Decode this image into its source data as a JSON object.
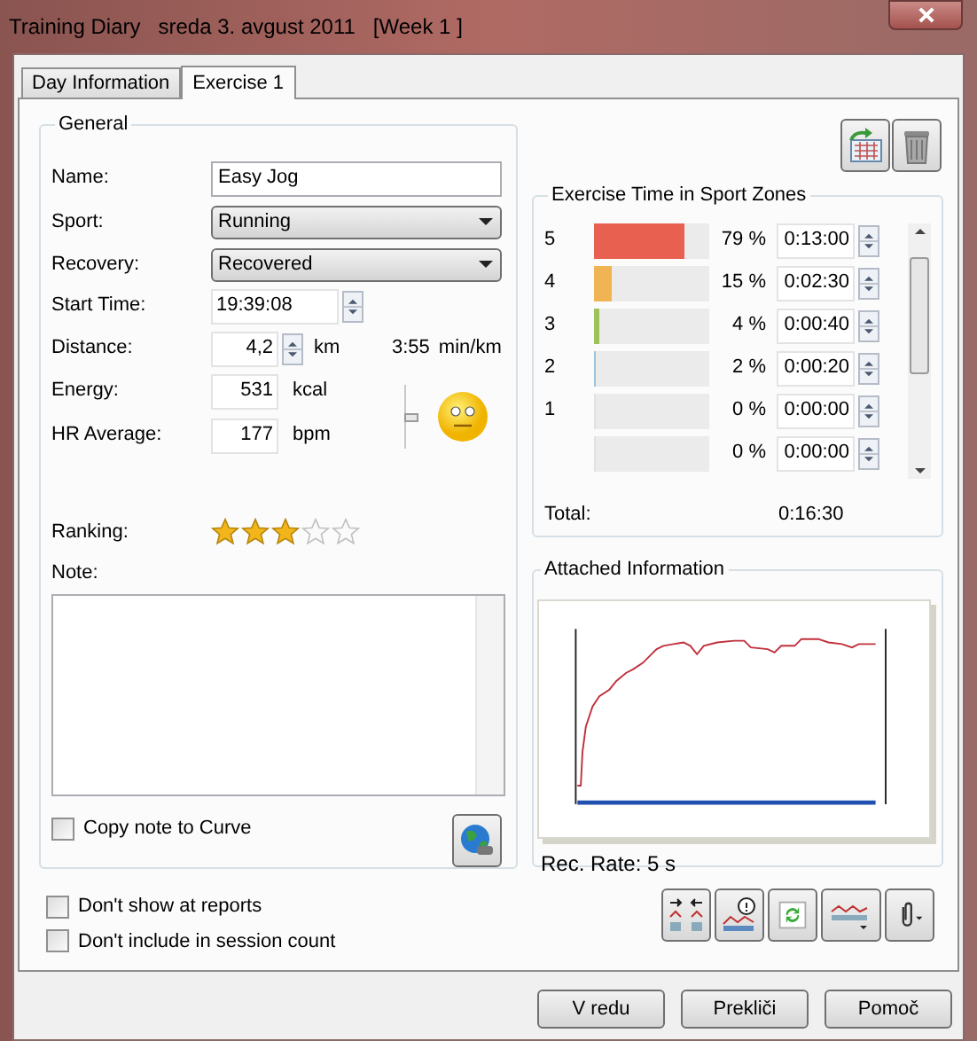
{
  "window": {
    "title": "Training Diary   sreda 3. avgust 2011   [Week 1 ]"
  },
  "tabs": [
    {
      "label": "Day Information",
      "selected": false
    },
    {
      "label": "Exercise 1",
      "selected": true
    }
  ],
  "general": {
    "legend": "General",
    "name": {
      "label": "Name:",
      "value": "Easy Jog"
    },
    "sport": {
      "label": "Sport:",
      "value": "Running"
    },
    "recovery": {
      "label": "Recovery:",
      "value": "Recovered"
    },
    "start_time": {
      "label": "Start Time:",
      "value": "19:39:08"
    },
    "distance": {
      "label": "Distance:",
      "value": "4,2",
      "unit": "km",
      "pace": "3:55",
      "pace_unit": "min/km"
    },
    "energy": {
      "label": "Energy:",
      "value": "531",
      "unit": "kcal"
    },
    "hr_average": {
      "label": "HR Average:",
      "value": "177",
      "unit": "bpm"
    },
    "feeling": {
      "level": 0.5
    },
    "ranking": {
      "label": "Ranking:",
      "stars": 3
    },
    "note": {
      "label": "Note:"
    },
    "copy_note": {
      "label": "Copy note to Curve",
      "checked": false
    }
  },
  "zones": {
    "legend": "Exercise Time in Sport Zones",
    "rows": [
      {
        "zone": "5",
        "level": 0.79,
        "percent": "79 %",
        "time": "0:13:00",
        "color": "#e8604f"
      },
      {
        "zone": "4",
        "level": 0.15,
        "percent": "15 %",
        "time": "0:02:30",
        "color": "#f0b454"
      },
      {
        "zone": "3",
        "level": 0.04,
        "percent": "4 %",
        "time": "0:00:40",
        "color": "#9dc25a"
      },
      {
        "zone": "2",
        "level": 0.02,
        "percent": "2 %",
        "time": "0:00:20",
        "color": "#9cc4dc"
      },
      {
        "zone": "1",
        "level": 0,
        "percent": "0 %",
        "time": "0:00:00"
      },
      {
        "level": 0,
        "percent": "0 %",
        "time": "0:00:00"
      }
    ],
    "total_label": "Total:",
    "total": "0:16:30"
  },
  "attached": {
    "legend": "Attached Information",
    "rec_rate": "Rec. Rate: 5 s"
  },
  "options": [
    {
      "label": "Don't show at reports",
      "checked": false
    },
    {
      "label": "Don't include in session count",
      "checked": false
    }
  ],
  "buttons": [
    "V redu",
    "Prekliči",
    "Pomoč"
  ]
}
